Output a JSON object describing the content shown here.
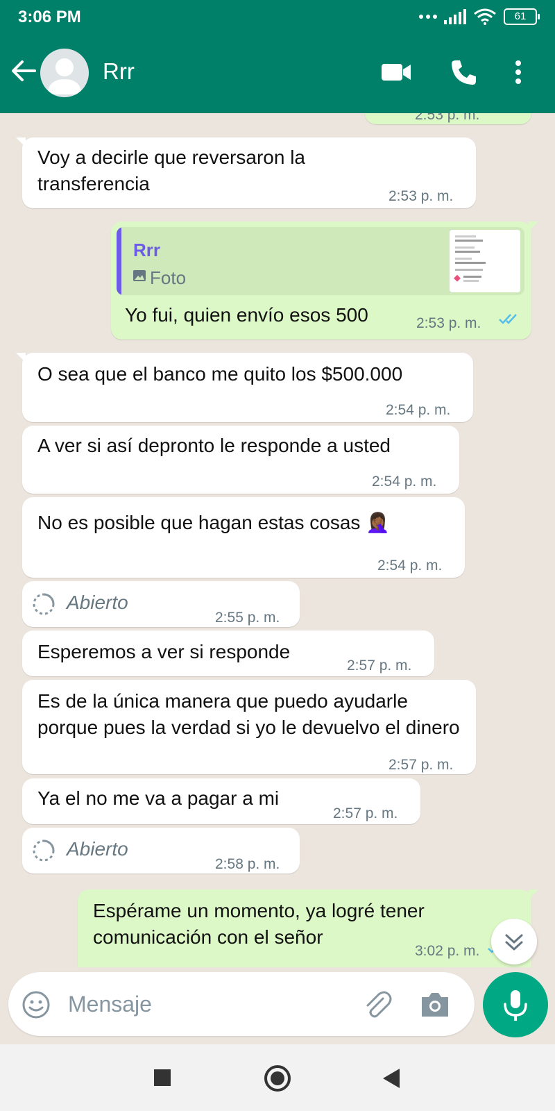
{
  "status_bar": {
    "time": "3:06 PM",
    "battery": "61"
  },
  "header": {
    "contact_name": "Rrr"
  },
  "messages": [
    {
      "dir": "out",
      "partial": true,
      "time": "2:53 p. m."
    },
    {
      "dir": "in",
      "text": "Voy a decirle que reversaron la transferencia",
      "time": "2:53 p. m."
    },
    {
      "dir": "out",
      "quote_name": "Rrr",
      "quote_type": "Foto",
      "text": "Yo fui, quien envío esos 500",
      "time": "2:53 p. m."
    },
    {
      "dir": "in",
      "text": "O sea que el banco me quito los $500.000",
      "time": "2:54 p. m."
    },
    {
      "dir": "in",
      "text": "A ver si así depronto le responde a usted",
      "time": "2:54 p. m."
    },
    {
      "dir": "in",
      "text": "No es posible que hagan estas cosas 🤦🏾‍♀️",
      "time": "2:54 p. m."
    },
    {
      "dir": "in",
      "text": "Abierto",
      "time": "2:55 p. m."
    },
    {
      "dir": "in",
      "text": "Esperemos a ver si responde",
      "time": "2:57 p. m."
    },
    {
      "dir": "in",
      "text": "Es de la única manera que puedo ayudarle porque pues la verdad si yo le devuelvo el dinero",
      "time": "2:57 p. m."
    },
    {
      "dir": "in",
      "text": "Ya el no me va a pagar a mi",
      "time": "2:57 p. m."
    },
    {
      "dir": "in",
      "text": "Abierto",
      "time": "2:58 p. m."
    },
    {
      "dir": "out",
      "text": "Espérame un momento, ya logré tener comunicación con el señor",
      "time": "3:02 p. m."
    }
  ],
  "composer": {
    "placeholder": "Mensaje"
  },
  "colors": {
    "header": "#008069",
    "chat_bg": "#ece5dd",
    "outgoing": "#dcf8c6",
    "incoming": "#ffffff",
    "read_ticks": "#53bdeb",
    "mic_button": "#00a884",
    "quote_accent": "#6b5be6"
  }
}
